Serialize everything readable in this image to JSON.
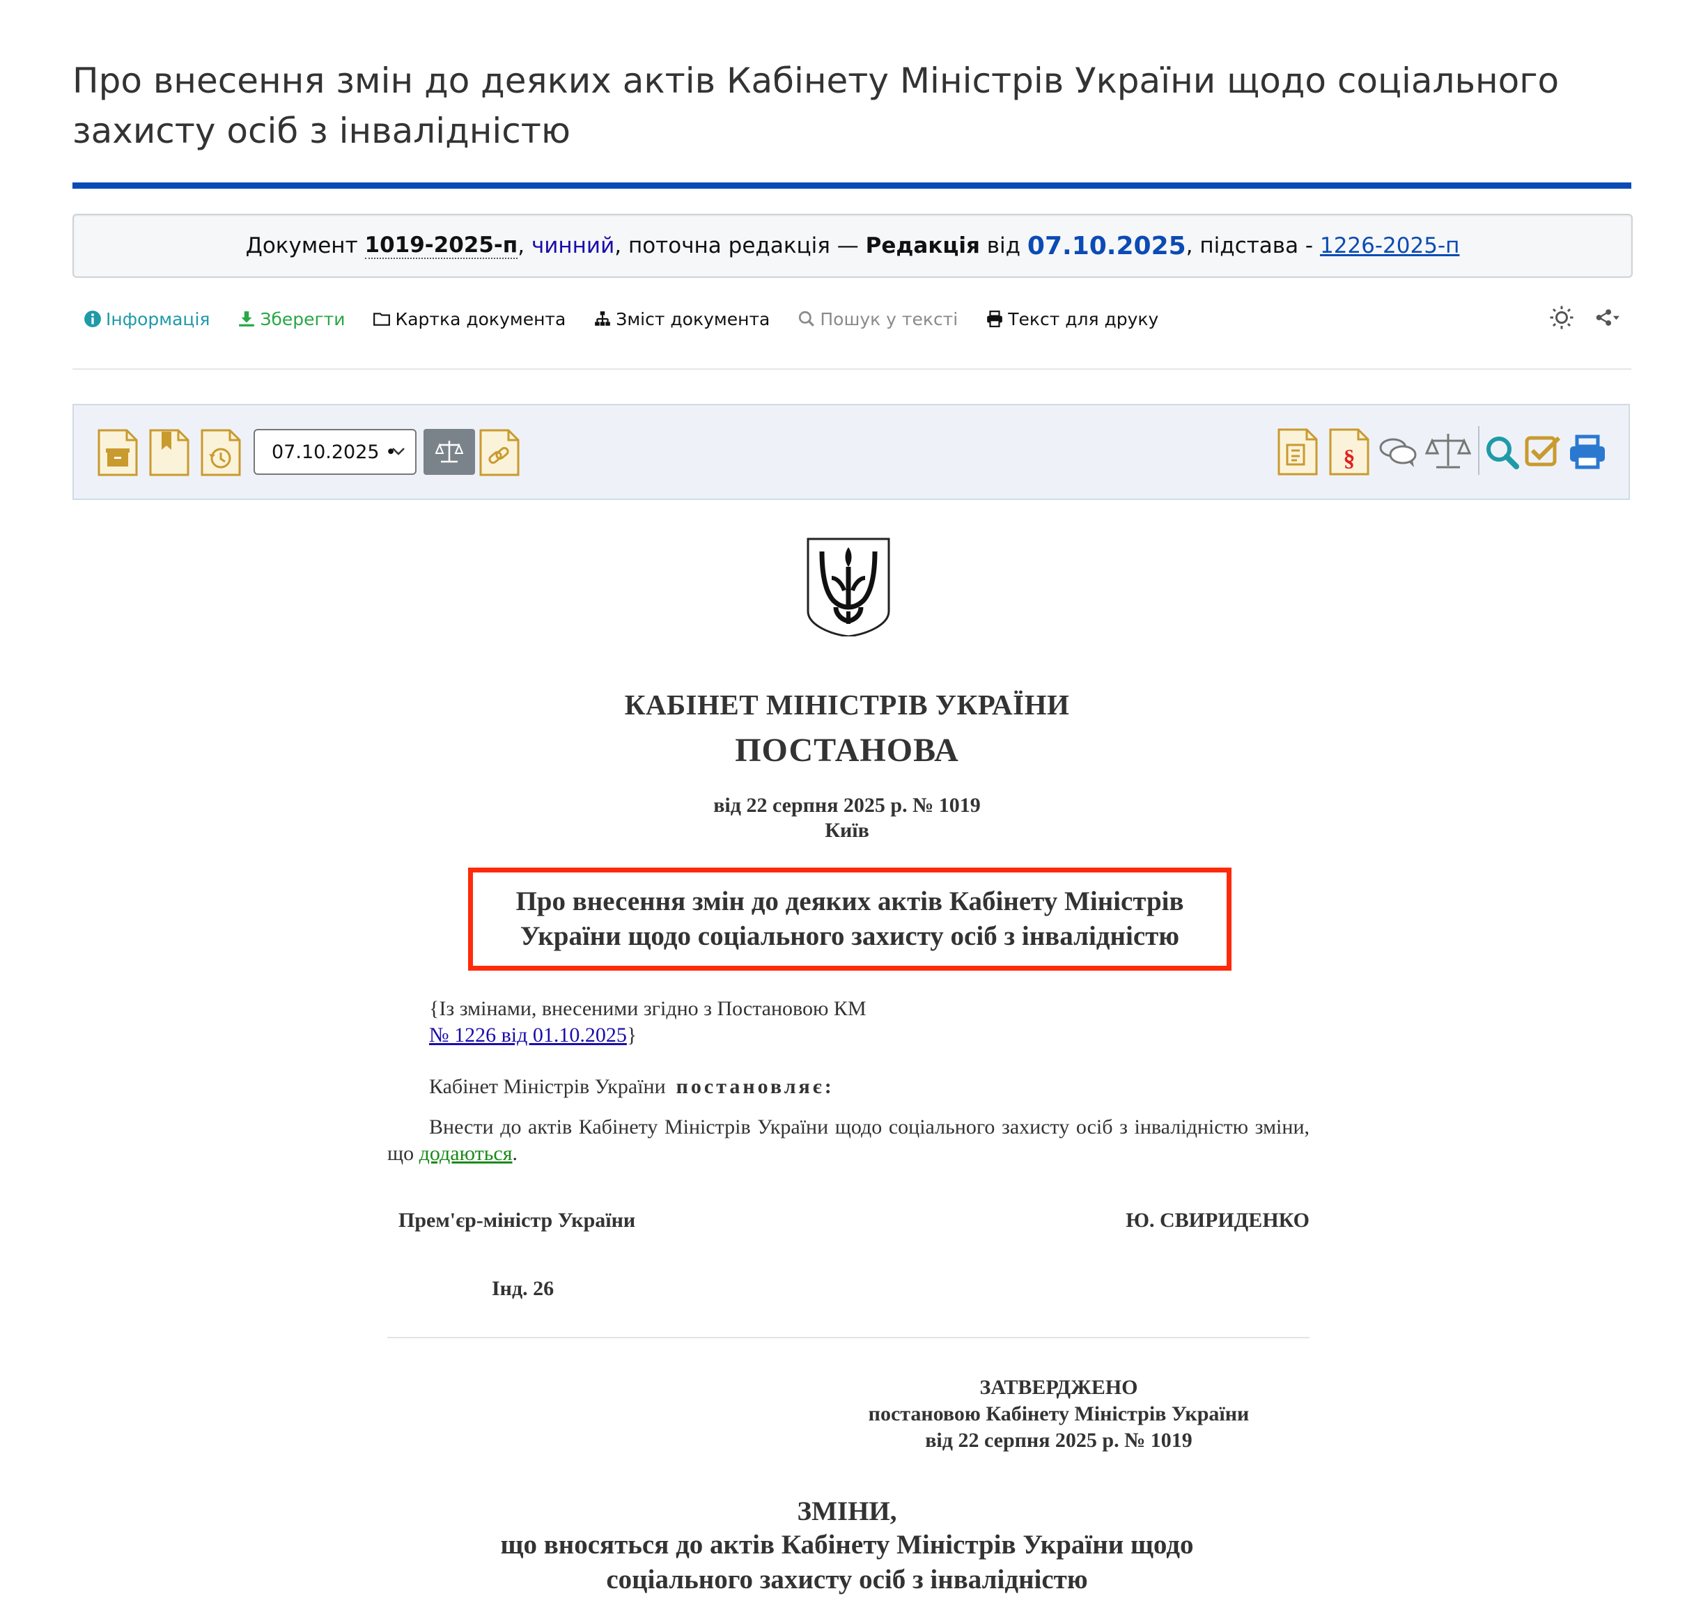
{
  "page": {
    "title": "Про внесення змін до деяких актів Кабінету Міністрів України щодо соціального захисту осіб з інвалідністю"
  },
  "status": {
    "prefix": "Документ ",
    "doc_number": "1019-2025-п",
    "sep1": ", ",
    "state": "чинний",
    "mid": ", поточна редакція — ",
    "edition_label": "Редакція",
    "from": " від ",
    "edition_date": "07.10.2025",
    "basis_label": ", підстава - ",
    "basis_link": "1226-2025-п"
  },
  "menu": {
    "info": "Інформація",
    "save": "Зберегти",
    "card": "Картка документа",
    "contents": "Зміст документа",
    "search": "Пошук у тексті",
    "print": "Текст для друку"
  },
  "toolbar": {
    "date_select": "07.10.2025 •"
  },
  "document": {
    "org": "КАБІНЕТ МІНІСТРІВ УКРАЇНИ",
    "type": "ПОСТАНОВА",
    "date_line": "від 22 серпня 2025 р. № 1019",
    "city": "Київ",
    "title_line1": "Про внесення змін до деяких актів Кабінету Міністрів",
    "title_line2": "України щодо соціального захисту осіб з інвалідністю",
    "amend_open": "{Із змінами, внесеними згідно з Постановою КМ",
    "amend_link": "№ 1226 від 01.10.2025",
    "amend_close": "}",
    "resolves_prefix": "Кабінет Міністрів України ",
    "resolves_word": "постановляє:",
    "body_text": "Внести до актів Кабінету Міністрів України щодо соціального захисту осіб з інвалідністю зміни, що ",
    "body_link": "додаються",
    "body_end": ".",
    "sig_position": "Прем'єр-міністр України",
    "sig_name": "Ю. СВИРИДЕНКО",
    "index": "Інд. 26",
    "approved": "ЗАТВЕРДЖЕНО",
    "approved_by": "постановою Кабінету Міністрів України",
    "approved_date": "від 22 серпня 2025 р. № 1019",
    "changes_title": "ЗМІНИ,",
    "changes_sub1": "що вносяться до актів Кабінету Міністрів України щодо",
    "changes_sub2": "соціального захисту осіб з інвалідністю"
  },
  "icons": {
    "info": "info-circle-icon",
    "save": "download-icon",
    "card": "folder-icon",
    "contents": "sitemap-icon",
    "search": "search-icon",
    "print": "print-icon",
    "theme": "sun-icon",
    "share": "share-icon",
    "emblem": "trident-emblem-icon"
  },
  "colors": {
    "accent_blue": "#0b4bb5",
    "highlight_red": "#ff2a0a",
    "toolbar_gold": "#c99a2e",
    "teal": "#1f9aa8",
    "green": "#28a745"
  }
}
